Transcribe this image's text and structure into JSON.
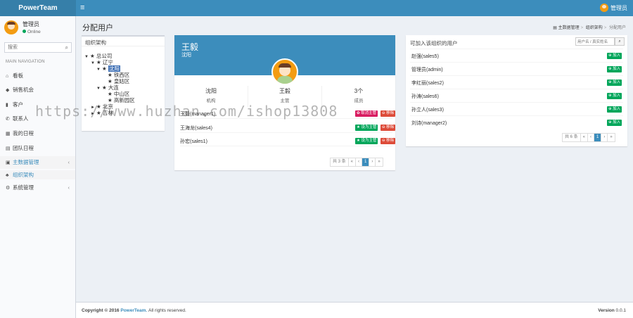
{
  "app": {
    "logo": "PowerTeam"
  },
  "header": {
    "menu_toggle": "≡",
    "user_name": "管理员"
  },
  "sidebar": {
    "user_name": "管理员",
    "user_status": "Online",
    "search_placeholder": "搜索",
    "nav_header": "MAIN NAVIGATION",
    "items": [
      {
        "icon": "dashboard-icon",
        "label": "看板"
      },
      {
        "icon": "chart-icon",
        "label": "销售机会"
      },
      {
        "icon": "customer-icon",
        "label": "客户"
      },
      {
        "icon": "phone-icon",
        "label": "联系人"
      },
      {
        "icon": "calendar-icon",
        "label": "我的日程"
      },
      {
        "icon": "team-icon",
        "label": "团队日程"
      },
      {
        "icon": "data-icon",
        "label": "主数据管理"
      },
      {
        "icon": "org-icon",
        "label": "组织架构"
      },
      {
        "icon": "gear-icon",
        "label": "系统管理"
      }
    ]
  },
  "page": {
    "title": "分配用户",
    "breadcrumb": [
      "主数据管理",
      "组织架构",
      "分配用户"
    ]
  },
  "tree": {
    "title": "组织架构",
    "nodes": [
      "总公司",
      "辽宁",
      "沈阳",
      "铁西区",
      "皇姑区",
      "大连",
      "中山区",
      "高新园区",
      "北京",
      "吉林"
    ]
  },
  "profile": {
    "name": "王毅",
    "subtitle": "沈阳",
    "stats": [
      {
        "value": "沈阳",
        "label": "机构"
      },
      {
        "value": "王毅",
        "label": "主管"
      },
      {
        "value": "3个",
        "label": "成员"
      }
    ],
    "members": [
      {
        "name": "王毅(manager1)",
        "actions": [
          "取消主管",
          "移除"
        ]
      },
      {
        "name": "王海龙(sales4)",
        "actions": [
          "设为主管",
          "移除"
        ]
      },
      {
        "name": "孙宏(sales1)",
        "actions": [
          "设为主管",
          "移除"
        ]
      }
    ],
    "pager": {
      "total": "共 3 条",
      "pages": [
        "«",
        "‹",
        "1",
        "›",
        "»"
      ]
    }
  },
  "available": {
    "title": "可加入该组织的用户",
    "search_placeholder": "用户名 / 真实姓名",
    "add_label": "加入",
    "users": [
      "赵强(sales5)",
      "管理员(admin)",
      "李红丽(sales2)",
      "孙涛(sales6)",
      "孙立人(sales3)",
      "刘诗(manager2)"
    ],
    "pager": {
      "total": "共 6 条",
      "pages": [
        "«",
        "‹",
        "1",
        "›",
        "»"
      ]
    }
  },
  "footer": {
    "copyright": "Copyright © 2016",
    "brand": "PowerTeam.",
    "rights": "All rights reserved.",
    "version_label": "Version",
    "version": "0.0.1"
  },
  "watermark": "https://www.huzhan.com/ishop13808",
  "colors": {
    "primary": "#3c8dbc",
    "success": "#00a65a",
    "danger": "#dd4b39",
    "pink": "#d81b60"
  }
}
